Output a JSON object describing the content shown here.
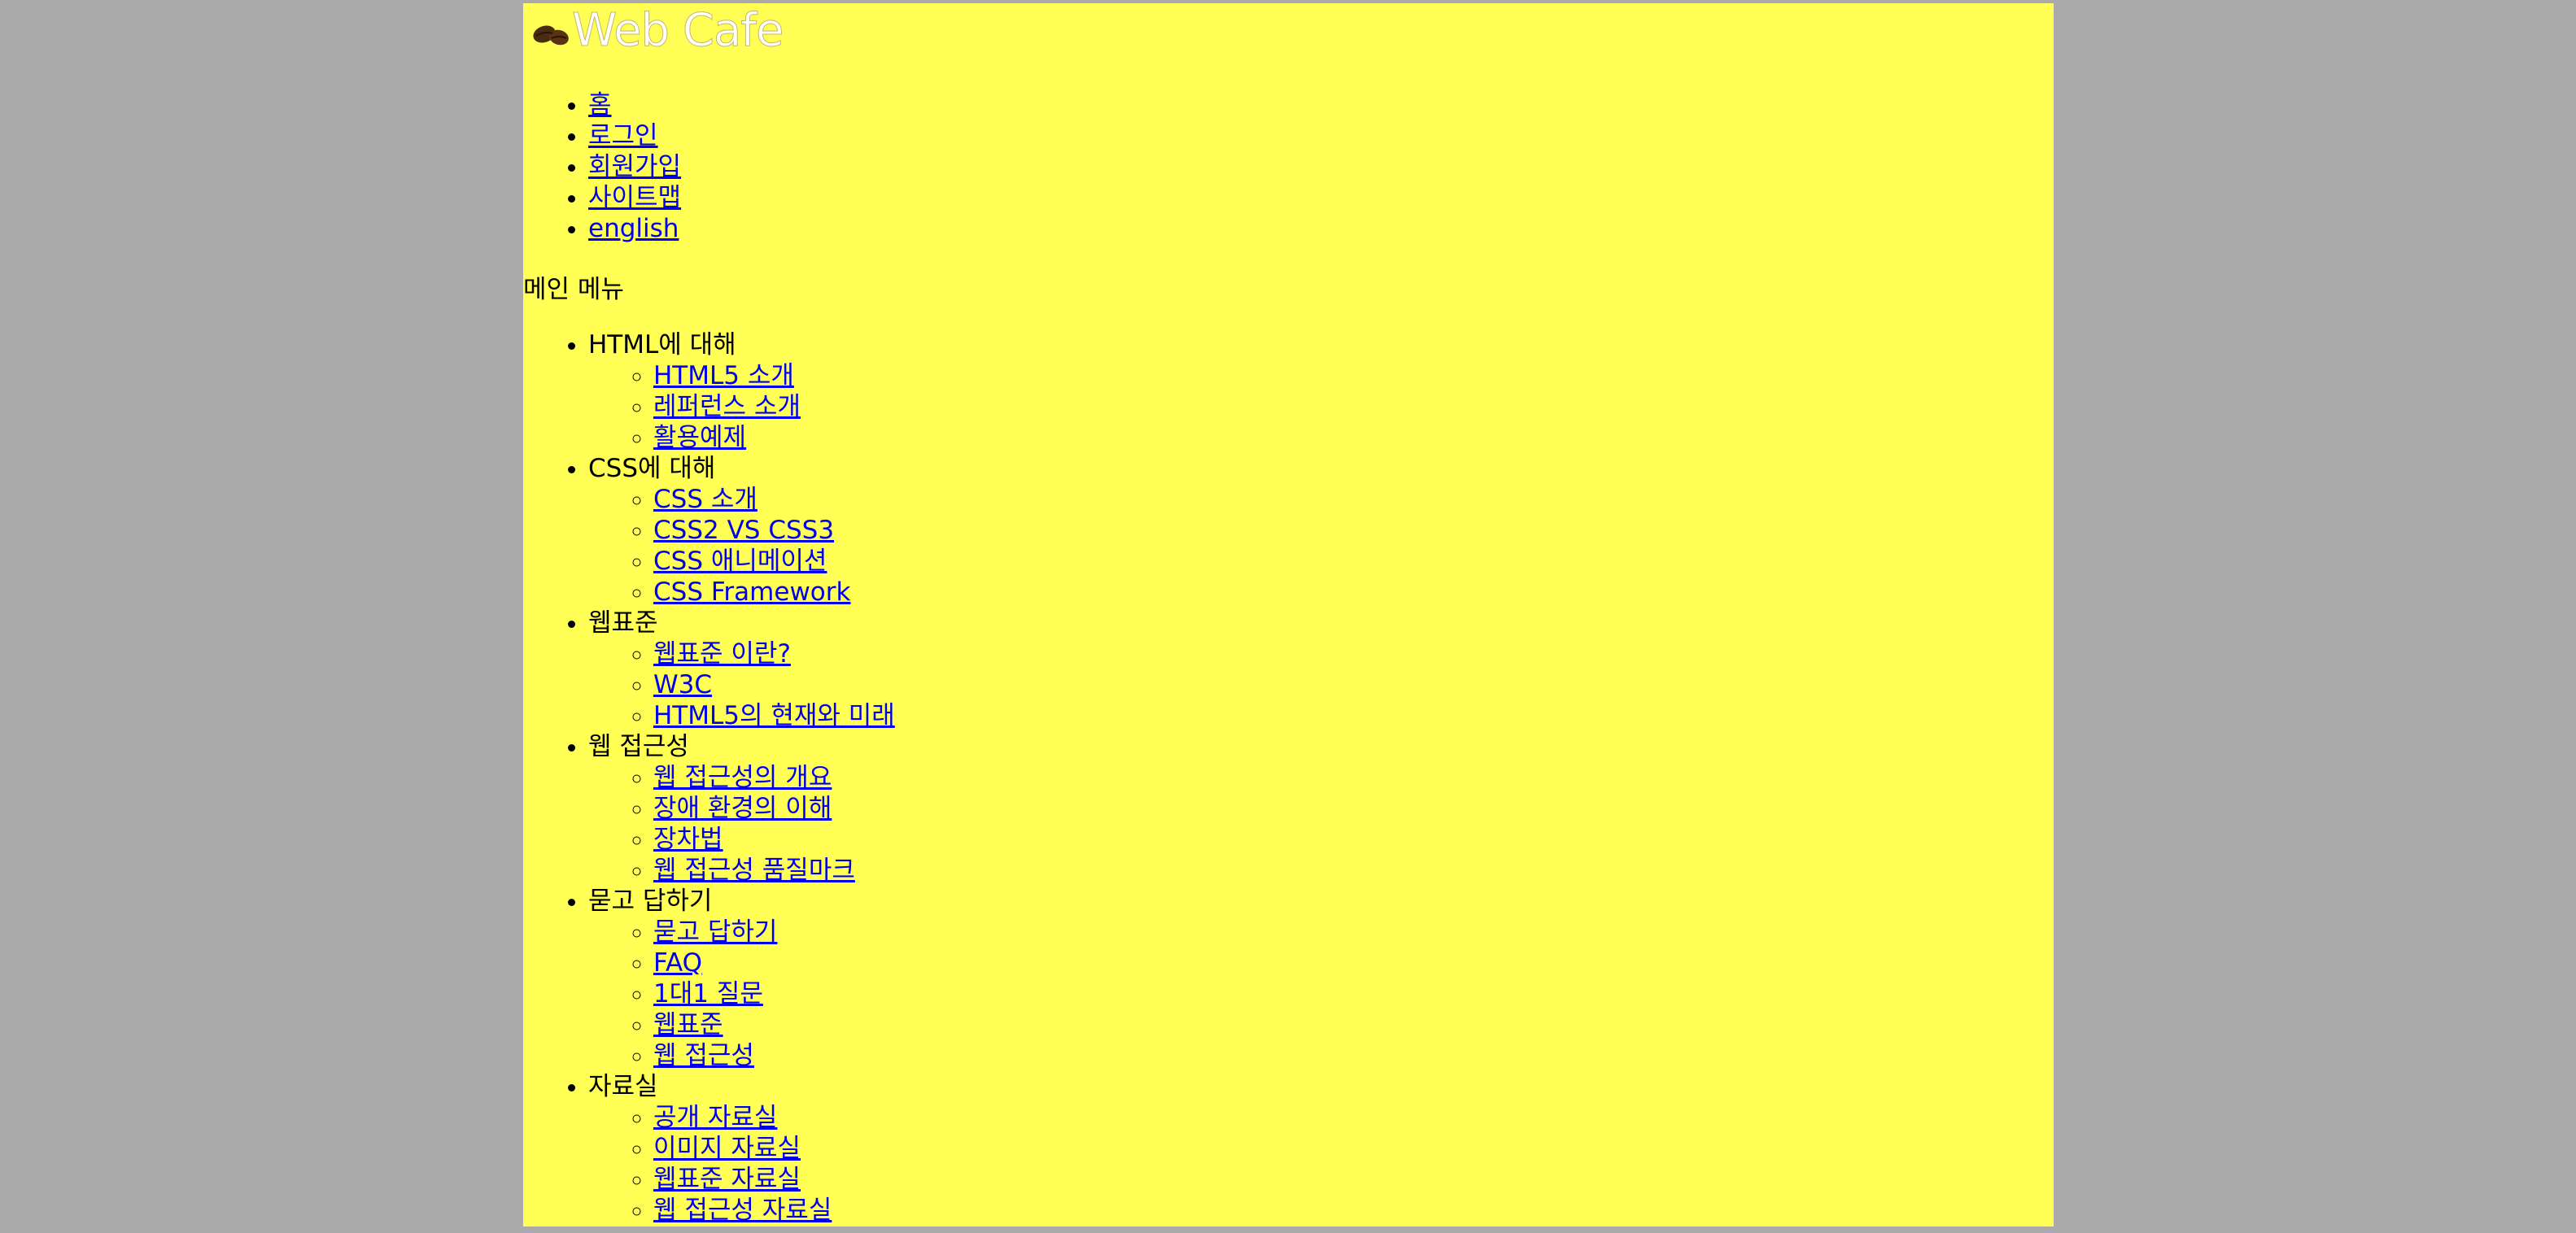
{
  "logo": {
    "text": "Web Cafe",
    "icon": "coffee-bean-icon",
    "color": "#ffffff"
  },
  "colors": {
    "page_background": "#aaaaaa",
    "content_background": "#ffff55",
    "link": "#0000ee"
  },
  "util_menu": [
    {
      "label": "홈"
    },
    {
      "label": "로그인"
    },
    {
      "label": "회원가입"
    },
    {
      "label": "사이트맵"
    },
    {
      "label": "english"
    }
  ],
  "main_menu": {
    "title": "메인 메뉴",
    "sections": [
      {
        "label": "HTML에 대해",
        "items": [
          {
            "label": "HTML5 소개"
          },
          {
            "label": "레퍼런스 소개"
          },
          {
            "label": "활용예제"
          }
        ]
      },
      {
        "label": "CSS에 대해",
        "items": [
          {
            "label": "CSS 소개"
          },
          {
            "label": "CSS2 VS CSS3"
          },
          {
            "label": "CSS 애니메이션"
          },
          {
            "label": "CSS Framework"
          }
        ]
      },
      {
        "label": "웹표준",
        "items": [
          {
            "label": "웹표준 이란?"
          },
          {
            "label": "W3C"
          },
          {
            "label": "HTML5의 현재와 미래"
          }
        ]
      },
      {
        "label": "웹 접근성",
        "items": [
          {
            "label": "웹 접근성의 개요"
          },
          {
            "label": "장애 환경의 이해"
          },
          {
            "label": "장차법"
          },
          {
            "label": "웹 접근성 품질마크"
          }
        ]
      },
      {
        "label": "묻고 답하기",
        "items": [
          {
            "label": "묻고 답하기"
          },
          {
            "label": "FAQ"
          },
          {
            "label": "1대1 질문"
          },
          {
            "label": "웹표준"
          },
          {
            "label": "웹 접근성"
          }
        ]
      },
      {
        "label": "자료실",
        "items": [
          {
            "label": "공개 자료실"
          },
          {
            "label": "이미지 자료실"
          },
          {
            "label": "웹표준 자료실"
          },
          {
            "label": "웹 접근성 자료실"
          }
        ]
      }
    ]
  }
}
